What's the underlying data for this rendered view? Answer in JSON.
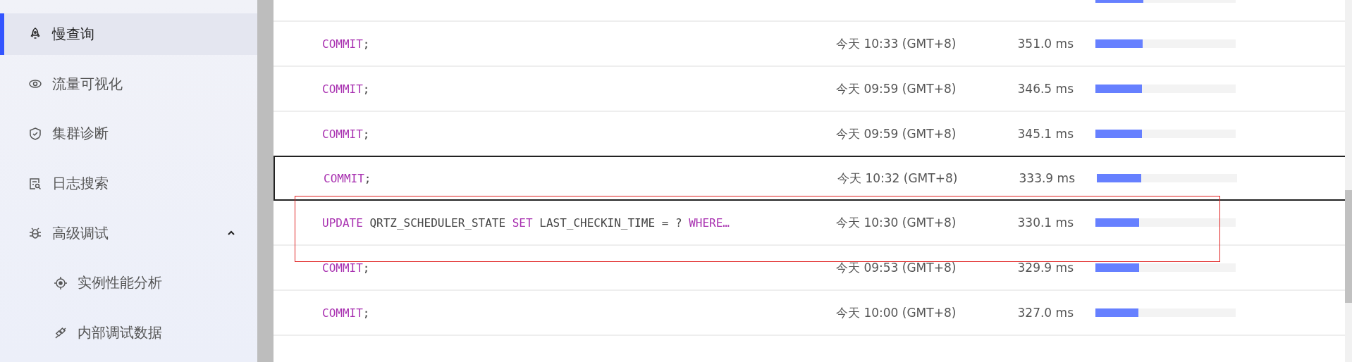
{
  "sidebar": {
    "items": [
      {
        "label": "慢查询",
        "selected": true
      },
      {
        "label": "流量可视化",
        "selected": false
      },
      {
        "label": "集群诊断",
        "selected": false
      },
      {
        "label": "日志搜索",
        "selected": false
      },
      {
        "label": "高级调试",
        "selected": false,
        "expanded": true,
        "children": [
          {
            "label": "实例性能分析",
            "selected": false
          },
          {
            "label": "内部调试数据",
            "selected": false
          }
        ]
      }
    ]
  },
  "table": {
    "rows": [
      {
        "level": 0.34,
        "hovered": false,
        "highlighted": false
      },
      {
        "sql": [
          {
            "kind": "keyword",
            "text": "COMMIT"
          },
          {
            "kind": "plain",
            "text": ";"
          }
        ],
        "time": "今天 10:33 (GMT+8)",
        "duration": "351.0 ms",
        "level": 0.335,
        "hovered": false,
        "highlighted": false
      },
      {
        "sql": [
          {
            "kind": "keyword",
            "text": "COMMIT"
          },
          {
            "kind": "plain",
            "text": ";"
          }
        ],
        "time": "今天 09:59 (GMT+8)",
        "duration": "346.5 ms",
        "level": 0.33,
        "hovered": false,
        "highlighted": false
      },
      {
        "sql": [
          {
            "kind": "keyword",
            "text": "COMMIT"
          },
          {
            "kind": "plain",
            "text": ";"
          }
        ],
        "time": "今天 09:59 (GMT+8)",
        "duration": "345.1 ms",
        "level": 0.33,
        "hovered": false,
        "highlighted": false
      },
      {
        "sql": [
          {
            "kind": "keyword",
            "text": "COMMIT"
          },
          {
            "kind": "plain",
            "text": ";"
          }
        ],
        "time": "今天 10:32 (GMT+8)",
        "duration": "333.9 ms",
        "level": 0.315,
        "hovered": true,
        "highlighted": false
      },
      {
        "sql": [
          {
            "kind": "keyword",
            "text": "UPDATE"
          },
          {
            "kind": "plain",
            "text": " QRTZ_SCHEDULER_STATE "
          },
          {
            "kind": "keyword",
            "text": "SET"
          },
          {
            "kind": "plain",
            "text": " LAST_CHECKIN_TIME = ? "
          },
          {
            "kind": "keyword",
            "text": "WHERE…"
          }
        ],
        "time": "今天 10:30 (GMT+8)",
        "duration": "330.1 ms",
        "level": 0.31,
        "hovered": false,
        "highlighted": true
      },
      {
        "sql": [
          {
            "kind": "keyword",
            "text": "COMMIT"
          },
          {
            "kind": "plain",
            "text": ";"
          }
        ],
        "time": "今天 09:53 (GMT+8)",
        "duration": "329.9 ms",
        "level": 0.31,
        "hovered": false,
        "highlighted": false
      },
      {
        "sql": [
          {
            "kind": "keyword",
            "text": "COMMIT"
          },
          {
            "kind": "plain",
            "text": ";"
          }
        ],
        "time": "今天 10:00 (GMT+8)",
        "duration": "327.0 ms",
        "level": 0.305,
        "hovered": false,
        "highlighted": false
      }
    ]
  }
}
